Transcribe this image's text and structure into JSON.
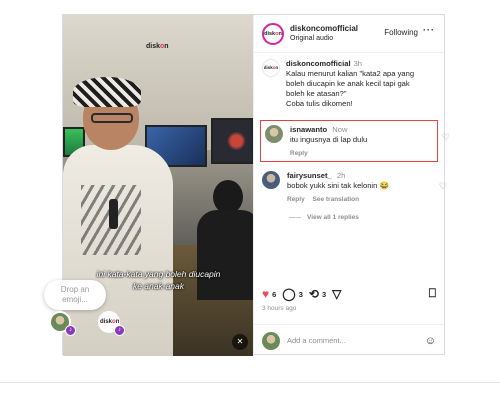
{
  "post": {
    "username": "diskoncomofficial",
    "audio": "Original audio",
    "follow_status": "Following",
    "more_icon": "more-horizontal-icon",
    "logo_text_a": "disk",
    "logo_text_o": "o",
    "logo_text_b": "n",
    "caption": {
      "username": "diskoncomofficial",
      "time": "3h",
      "text_lines": [
        "Kalau menurut kalian \"kata2 apa yang",
        "boleh diucapin ke anak kecil tapi gak",
        "boleh ke atasan?\"",
        "Coba tulis dikomen!"
      ]
    },
    "video_overlay_lines": [
      "ini kata-kata yang boleh diucapin",
      "ke anak-anak"
    ],
    "reaction_prompt": [
      "Drop an",
      "emoji..."
    ],
    "mute_icon": "muted-speaker-icon"
  },
  "comments": [
    {
      "username": "isnawanto",
      "time": "Now",
      "text": "itu ingusnya di lap dulu",
      "actions": [
        "Reply"
      ],
      "highlighted": true,
      "avatar_color": "#7d8f6a"
    },
    {
      "username": "fairysunset_",
      "time": "2h",
      "text": "bobok yukk sini tak kelonin 😂",
      "actions": [
        "Reply",
        "See translation"
      ],
      "highlighted": false,
      "avatar_color": "#4a5d7a"
    }
  ],
  "view_replies": "View all 1 replies",
  "actions": {
    "likes": "6",
    "comments": "3",
    "reposts": "3",
    "time_ago": "3 hours ago"
  },
  "add_comment": {
    "placeholder": "Add a comment..."
  },
  "colors": {
    "like_red": "#ed4956",
    "highlight_border": "#e0443e",
    "brand_pink": "#e1306c"
  }
}
